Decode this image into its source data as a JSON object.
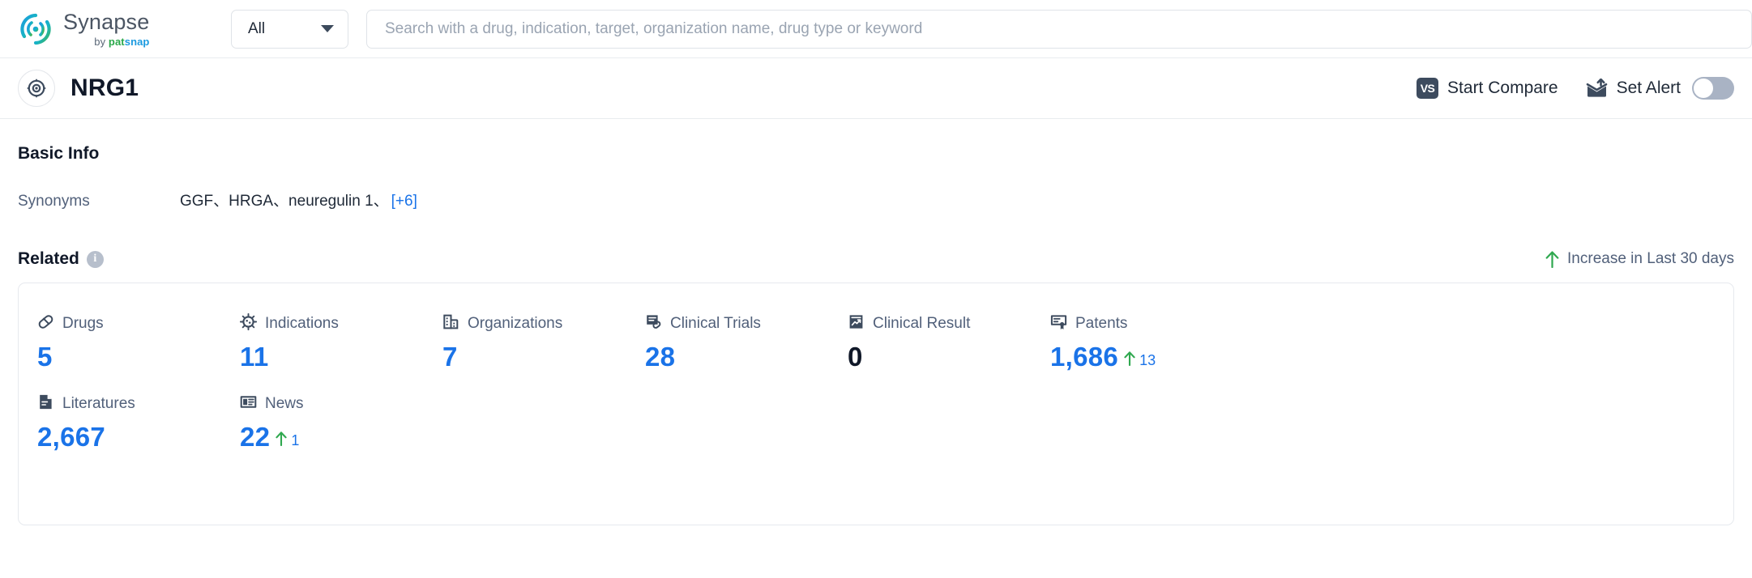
{
  "brand": {
    "name": "Synapse",
    "by": "by",
    "pat": "pat",
    "snap": "snap"
  },
  "search": {
    "scope_value": "All",
    "placeholder": "Search with a drug, indication, target, organization name, drug type or keyword",
    "value": ""
  },
  "entity": {
    "title": "NRG1",
    "compare_label": "Start Compare",
    "alert_label": "Set Alert",
    "vs_badge": "VS",
    "alert_enabled": false
  },
  "basic_info": {
    "title": "Basic Info",
    "synonyms_label": "Synonyms",
    "synonyms_value": "GGF、HRGA、neuregulin 1、",
    "synonyms_more": "[+6]"
  },
  "related": {
    "title": "Related",
    "info_glyph": "i",
    "legend_text": "Increase in Last 30 days",
    "legend_arrow": "↑",
    "metrics": [
      {
        "icon": "pill-icon",
        "label": "Drugs",
        "value": "5",
        "is_zero": false,
        "delta": null
      },
      {
        "icon": "virus-icon",
        "label": "Indications",
        "value": "11",
        "is_zero": false,
        "delta": null
      },
      {
        "icon": "organization-icon",
        "label": "Organizations",
        "value": "7",
        "is_zero": false,
        "delta": null
      },
      {
        "icon": "clinical-trial-icon",
        "label": "Clinical Trials",
        "value": "28",
        "is_zero": false,
        "delta": null
      },
      {
        "icon": "clinical-result-icon",
        "label": "Clinical Result",
        "value": "0",
        "is_zero": true,
        "delta": null
      },
      {
        "icon": "patent-icon",
        "label": "Patents",
        "value": "1,686",
        "is_zero": false,
        "delta": "13"
      },
      {
        "icon": "literature-icon",
        "label": "Literatures",
        "value": "2,667",
        "is_zero": false,
        "delta": null
      },
      {
        "icon": "news-icon",
        "label": "News",
        "value": "22",
        "is_zero": false,
        "delta": "1"
      }
    ]
  },
  "colors": {
    "accent_blue": "#1a73e8",
    "increase_green": "#2fa84f",
    "text_dark": "#101828",
    "text_muted": "#51607a"
  }
}
